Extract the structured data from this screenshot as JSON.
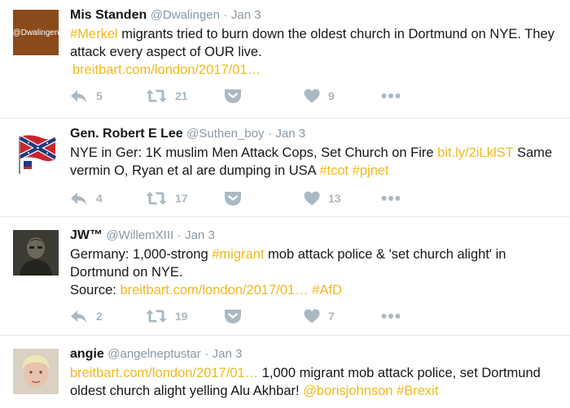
{
  "colors": {
    "link": "#f2b81c",
    "meta": "#8899a6",
    "icon": "#aab8c2",
    "divider": "#e1e8ed"
  },
  "tweets": [
    {
      "name": "Mis Standen",
      "handle": "@Dwalingen",
      "time": "Jan 3",
      "avatar_text": "@Dwalingen",
      "text": {
        "hashtag1": "#Merkel",
        "t1": " migrants tried to burn down the oldest church in Dortmund on NYE. They attack every aspect of OUR live.",
        "link1": "breitbart.com/london/2017/01…"
      },
      "counts": {
        "reply": "5",
        "retweet": "21",
        "like": "9"
      }
    },
    {
      "name": "Gen. Robert E Lee",
      "handle": "@Suthen_boy",
      "time": "Jan 3",
      "text": {
        "t1": "NYE in Ger: 1K muslim Men Attack Cops, Set Church on Fire ",
        "link1": "bit.ly/2iLklST",
        "t2": " Same vermin O, Ryan et al are dumping in USA ",
        "hashtag1": "#tcot",
        "hashtag2": "#pjnet"
      },
      "counts": {
        "reply": "4",
        "retweet": "17",
        "like": "13"
      }
    },
    {
      "name": "JW™",
      "handle": "@WillemXIII",
      "time": "Jan 3",
      "text": {
        "t1": "Germany: 1,000-strong ",
        "hashtag1": "#migrant",
        "t2": " mob attack police & 'set church alight' in Dortmund on NYE.",
        "t3": "Source: ",
        "link1": "breitbart.com/london/2017/01…",
        "hashtag2": "#AfD"
      },
      "counts": {
        "reply": "2",
        "retweet": "19",
        "like": "7"
      }
    },
    {
      "name": "angie",
      "handle": "@angelneptustar",
      "time": "Jan 3",
      "text": {
        "link1": "breitbart.com/london/2017/01…",
        "t1": " 1,000 migrant mob attack police, set Dortmund oldest church alight yelling Alu Akhbar!  ",
        "mention1": "@borisjohnson",
        "hashtag1": "#Brexit"
      }
    }
  ]
}
